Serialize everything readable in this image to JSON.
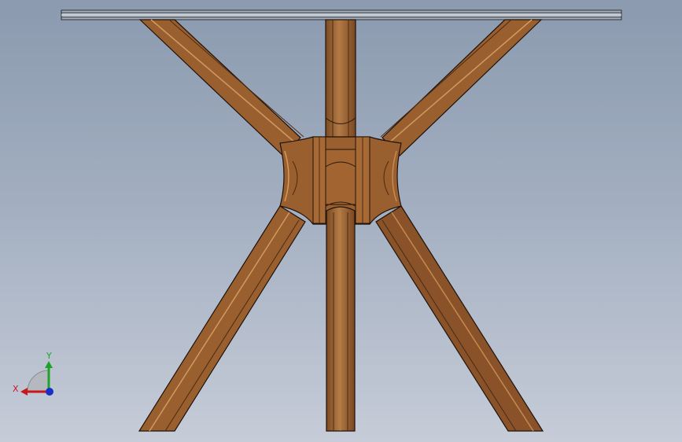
{
  "viewport": {
    "model": "table-base",
    "colors": {
      "wood": "#9a5f2e",
      "wood_light": "#b27a45",
      "wood_dark": "#6e4020",
      "outline": "#1e120a",
      "glass_top": "#b9c0c9",
      "background_top": "#8b9aaf",
      "background_bottom": "#c6ccd8"
    }
  },
  "triad": {
    "x_label": "X",
    "y_label": "Y",
    "x_color": "#c8181e",
    "y_color": "#1fa22a",
    "z_color": "#1b2fc4"
  }
}
